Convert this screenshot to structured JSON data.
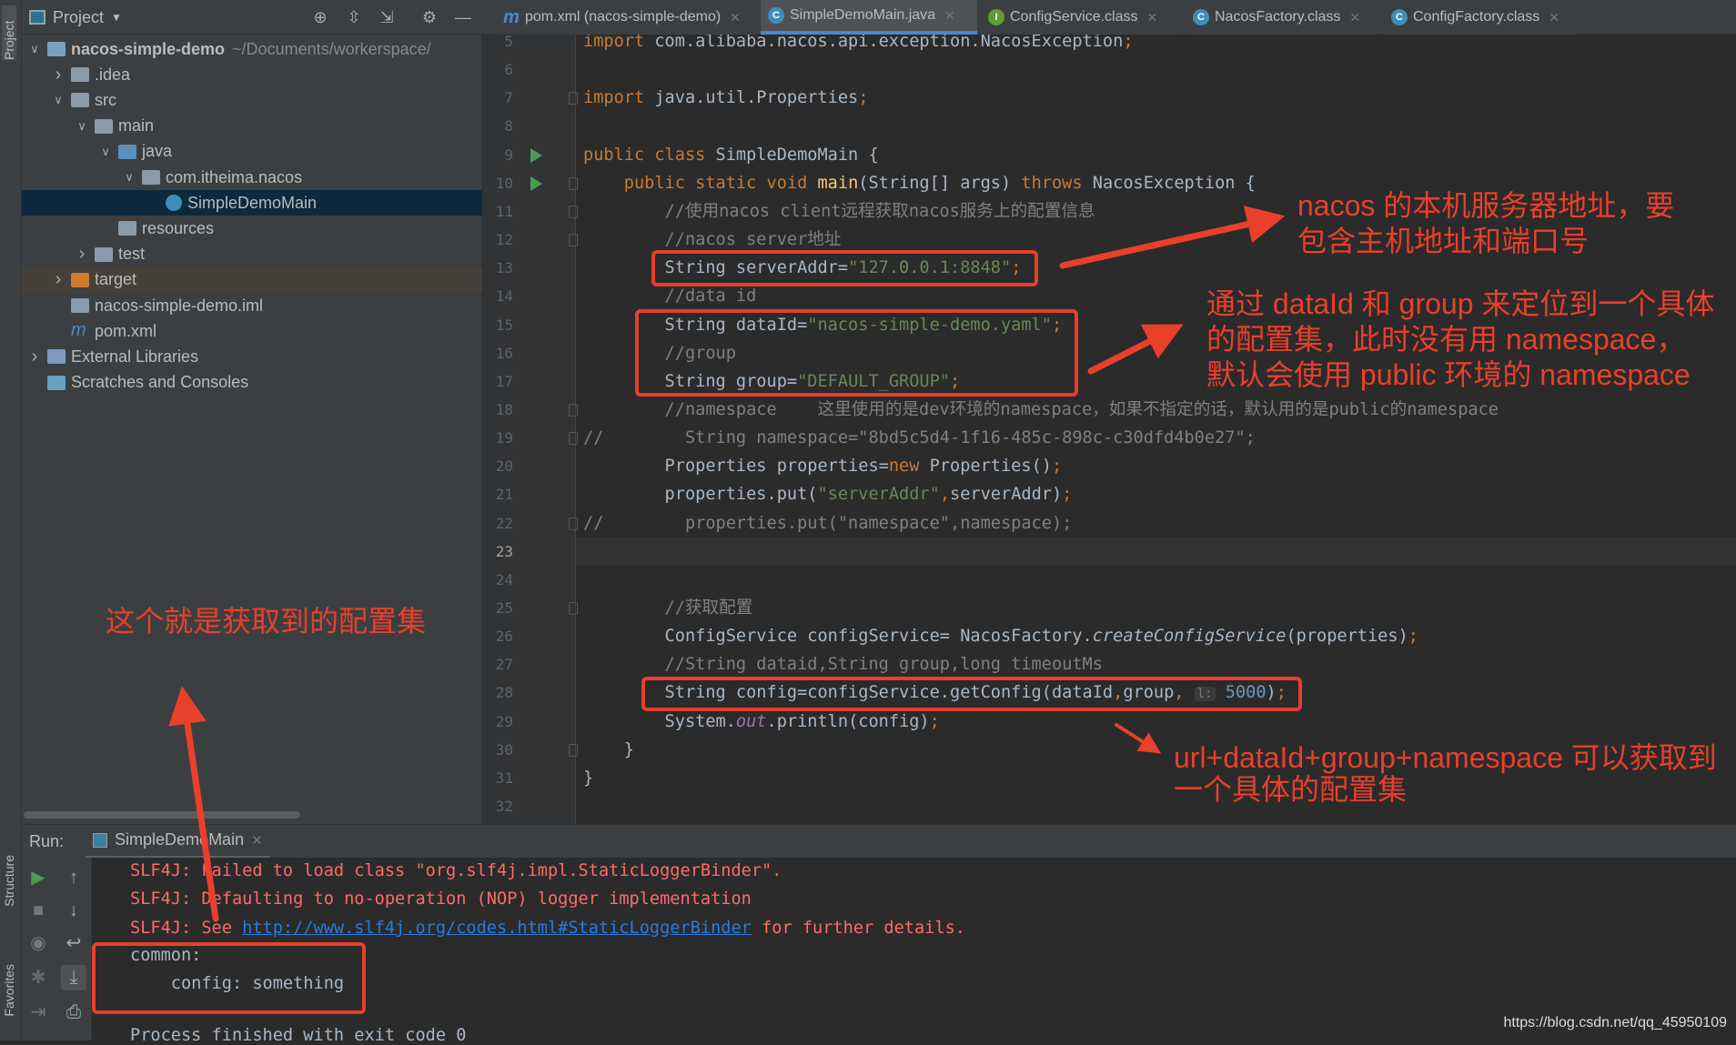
{
  "side_strip": {
    "project": "Project",
    "structure": "Structure",
    "favorites": "Favorites"
  },
  "project_panel": {
    "title": "Project",
    "tree": [
      {
        "label": "nacos-simple-demo",
        "hint": "~/Documents/workerspace/",
        "depth": 0,
        "arrow": "down",
        "icon": "module-folder",
        "bold": true
      },
      {
        "label": ".idea",
        "depth": 1,
        "arrow": "right",
        "icon": "folder"
      },
      {
        "label": "src",
        "depth": 1,
        "arrow": "down",
        "icon": "folder"
      },
      {
        "label": "main",
        "depth": 2,
        "arrow": "down",
        "icon": "folder"
      },
      {
        "label": "java",
        "depth": 3,
        "arrow": "down",
        "icon": "source-folder"
      },
      {
        "label": "com.itheima.nacos",
        "depth": 4,
        "arrow": "down",
        "icon": "package"
      },
      {
        "label": "SimpleDemoMain",
        "depth": 5,
        "arrow": "",
        "icon": "class",
        "selected": true
      },
      {
        "label": "resources",
        "depth": 3,
        "arrow": "",
        "icon": "resources-folder"
      },
      {
        "label": "test",
        "depth": 2,
        "arrow": "right",
        "icon": "folder"
      },
      {
        "label": "target",
        "depth": 1,
        "arrow": "right",
        "icon": "excluded-folder",
        "highlight": true
      },
      {
        "label": "nacos-simple-demo.iml",
        "depth": 1,
        "arrow": "",
        "icon": "iml-file"
      },
      {
        "label": "pom.xml",
        "depth": 1,
        "arrow": "",
        "icon": "maven-file"
      },
      {
        "label": "External Libraries",
        "depth": 0,
        "arrow": "right",
        "icon": "libraries"
      },
      {
        "label": "Scratches and Consoles",
        "depth": 0,
        "arrow": "",
        "icon": "scratches"
      }
    ]
  },
  "tabs": [
    {
      "label": "pom.xml (nacos-simple-demo)",
      "icon": "maven-icon",
      "active": false
    },
    {
      "label": "SimpleDemoMain.java",
      "icon": "class-icon",
      "active": true
    },
    {
      "label": "ConfigService.class",
      "icon": "interface-icon",
      "active": false
    },
    {
      "label": "NacosFactory.class",
      "icon": "class-icon",
      "active": false
    },
    {
      "label": "ConfigFactory.class",
      "icon": "class-icon",
      "active": false
    }
  ],
  "editor": {
    "current_line": 23,
    "lines": [
      {
        "n": 5,
        "seg": [
          [
            "import",
            "kw"
          ],
          [
            " com.alibaba.nacos.api.exception.NacosException",
            ""
          ],
          [
            ";",
            "kw"
          ]
        ]
      },
      {
        "n": 6,
        "seg": []
      },
      {
        "n": 7,
        "seg": [
          [
            "import",
            "kw"
          ],
          [
            " java.util.Properties",
            ""
          ],
          [
            ";",
            "kw"
          ]
        ]
      },
      {
        "n": 8,
        "seg": []
      },
      {
        "n": 9,
        "seg": [
          [
            "public class ",
            "kw"
          ],
          [
            "SimpleDemoMain {",
            ""
          ]
        ],
        "run": true
      },
      {
        "n": 10,
        "seg": [
          [
            "    public static void ",
            "kw"
          ],
          [
            "main",
            "fn"
          ],
          [
            "(String[] args) ",
            ""
          ],
          [
            "throws ",
            "kw"
          ],
          [
            "NacosException {",
            ""
          ]
        ],
        "run": true
      },
      {
        "n": 11,
        "seg": [
          [
            "        //使用nacos client远程获取nacos服务上的配置信息",
            "cm"
          ]
        ]
      },
      {
        "n": 12,
        "seg": [
          [
            "        //nacos server地址",
            "cm"
          ]
        ]
      },
      {
        "n": 13,
        "seg": [
          [
            "        String serverAddr=",
            ""
          ],
          [
            "\"127.0.0.1:8848\"",
            "str"
          ],
          [
            ";",
            "kw"
          ]
        ]
      },
      {
        "n": 14,
        "seg": [
          [
            "        //data id",
            "cm"
          ]
        ]
      },
      {
        "n": 15,
        "seg": [
          [
            "        String dataId=",
            ""
          ],
          [
            "\"nacos-simple-demo.yaml\"",
            "str"
          ],
          [
            ";",
            "kw"
          ]
        ]
      },
      {
        "n": 16,
        "seg": [
          [
            "        //group",
            "cm"
          ]
        ]
      },
      {
        "n": 17,
        "seg": [
          [
            "        String group=",
            ""
          ],
          [
            "\"DEFAULT_GROUP\"",
            "str"
          ],
          [
            ";",
            "kw"
          ]
        ]
      },
      {
        "n": 18,
        "seg": [
          [
            "        //namespace    这里使用的是dev环境的namespace，如果不指定的话，默认用的是public的namespace",
            "cm"
          ]
        ]
      },
      {
        "n": 19,
        "seg": [
          [
            "//        String namespace=\"8bd5c5d4-1f16-485c-898c-c30dfd4b0e27\";",
            "cm"
          ]
        ]
      },
      {
        "n": 20,
        "seg": [
          [
            "        Properties properties=",
            ""
          ],
          [
            "new",
            "kw"
          ],
          [
            " Properties()",
            ""
          ],
          [
            ";",
            "kw"
          ]
        ]
      },
      {
        "n": 21,
        "seg": [
          [
            "        properties.put(",
            ""
          ],
          [
            "\"serverAddr\"",
            "str"
          ],
          [
            ",",
            "kw"
          ],
          [
            "serverAddr)",
            ""
          ],
          [
            ";",
            "kw"
          ]
        ]
      },
      {
        "n": 22,
        "seg": [
          [
            "//        properties.put(\"namespace\",namespace);",
            "cm"
          ]
        ]
      },
      {
        "n": 23,
        "seg": []
      },
      {
        "n": 24,
        "seg": []
      },
      {
        "n": 25,
        "seg": [
          [
            "        //获取配置",
            "cm"
          ]
        ]
      },
      {
        "n": 26,
        "seg": [
          [
            "        ConfigService configService= NacosFactory.",
            ""
          ],
          [
            "createConfigService",
            "it"
          ],
          [
            "(properties)",
            ""
          ],
          [
            ";",
            "kw"
          ]
        ]
      },
      {
        "n": 27,
        "seg": [
          [
            "        //String dataid,String group,long timeoutMs",
            "cm"
          ]
        ]
      },
      {
        "n": 28,
        "seg": [
          [
            "        String config=configService.getConfig(dataId",
            ""
          ],
          [
            ",",
            "kw"
          ],
          [
            "group",
            ""
          ],
          [
            ",",
            "kw"
          ],
          [
            " ",
            ""
          ],
          [
            "l:",
            "hint"
          ],
          [
            " ",
            ""
          ],
          [
            "5000",
            "num"
          ],
          [
            ")",
            ""
          ],
          [
            ";",
            "kw"
          ]
        ]
      },
      {
        "n": 29,
        "seg": [
          [
            "        System.",
            ""
          ],
          [
            "out",
            "st"
          ],
          [
            ".println(config)",
            ""
          ],
          [
            ";",
            "kw"
          ]
        ]
      },
      {
        "n": 30,
        "seg": [
          [
            "    }",
            ""
          ]
        ]
      },
      {
        "n": 31,
        "seg": [
          [
            "}",
            ""
          ]
        ]
      },
      {
        "n": 32,
        "seg": []
      }
    ]
  },
  "run_panel": {
    "label": "Run:",
    "tab": "SimpleDemoMain",
    "console": [
      {
        "text": "SLF4J: Failed to load class \"org.slf4j.impl.StaticLoggerBinder\".",
        "type": "err"
      },
      {
        "text": "SLF4J: Defaulting to no-operation (NOP) logger implementation",
        "type": "err"
      },
      {
        "text": "SLF4J: See ",
        "type": "err",
        "link": "http://www.slf4j.org/codes.html#StaticLoggerBinder",
        "after": " for further details."
      },
      {
        "text": "common:",
        "type": "out"
      },
      {
        "text": "    config: something",
        "type": "out"
      },
      {
        "text": "Process finished with exit code 0",
        "type": "out"
      }
    ]
  },
  "annotations": {
    "server_addr": [
      "nacos 的本机服务器地址，要",
      "包含主机地址和端口号"
    ],
    "data_id_group": [
      "通过 dataId 和 group 来定位到一个具体",
      "的配置集，此时没有用 namespace，",
      "默认会使用 public 环境的 namespace"
    ],
    "get_config": [
      "url+dataId+group+namespace 可以获取到",
      "一个具体的配置集"
    ],
    "result": "这个就是获取到的配置集",
    "color": "#e8402a"
  },
  "watermark": "https://blog.csdn.net/qq_45950109",
  "colors": {
    "keyword": "#cc7832",
    "string": "#6a8759",
    "comment": "#808080",
    "text": "#a9b7c6",
    "number": "#6897bb",
    "error": "#ff6b68",
    "link": "#287bde",
    "accent": "#4a88c7"
  }
}
